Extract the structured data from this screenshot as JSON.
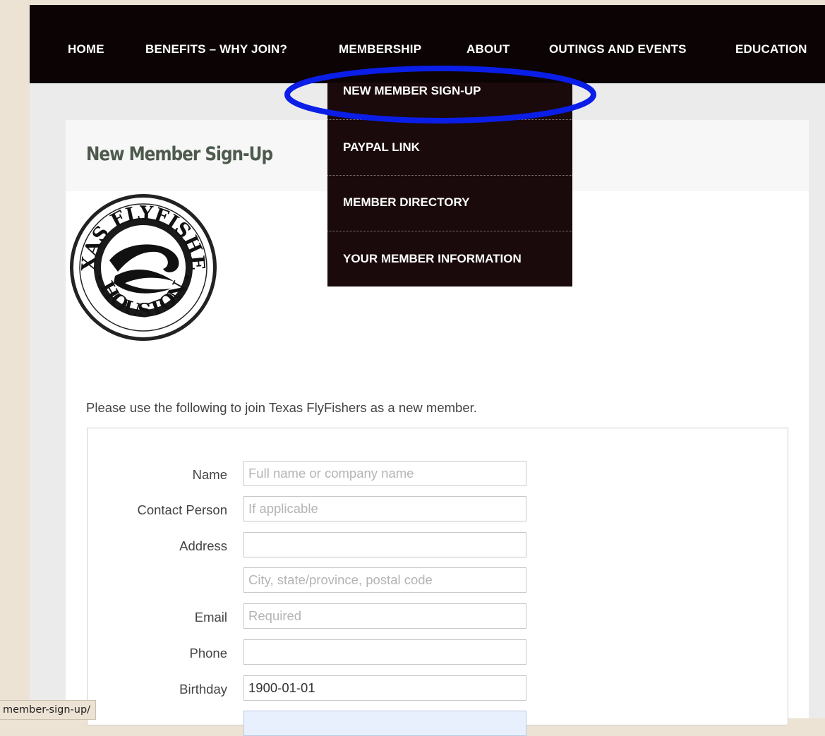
{
  "nav": {
    "items": [
      {
        "label": "HOME"
      },
      {
        "label": "BENEFITS – WHY JOIN?"
      },
      {
        "label": "MEMBERSHIP"
      },
      {
        "label": "ABOUT"
      },
      {
        "label": "OUTINGS AND EVENTS"
      },
      {
        "label": "EDUCATION"
      }
    ]
  },
  "dropdown": {
    "items": [
      {
        "label": "NEW MEMBER SIGN-UP",
        "highlighted": true
      },
      {
        "label": "PAYPAL LINK"
      },
      {
        "label": "MEMBER DIRECTORY"
      },
      {
        "label": "YOUR MEMBER INFORMATION"
      }
    ],
    "highlight_color": "#0a1ee8"
  },
  "page": {
    "title": "New Member Sign-Up",
    "intro": "Please use the following to join Texas FlyFishers as a new member."
  },
  "logo": {
    "text_top": "TEXAS FLYFISHERS",
    "text_bottom": "HOUSTON"
  },
  "form": {
    "fields": [
      {
        "label": "Name",
        "value": "",
        "placeholder": "Full name or company name"
      },
      {
        "label": "Contact Person",
        "value": "",
        "placeholder": "If applicable"
      },
      {
        "label": "Address",
        "value": "",
        "placeholder": ""
      },
      {
        "label": "",
        "value": "",
        "placeholder": "City, state/province, postal code"
      },
      {
        "label": "Email",
        "value": "",
        "placeholder": "Required"
      },
      {
        "label": "Phone",
        "value": "",
        "placeholder": ""
      },
      {
        "label": "Birthday",
        "value": "1900-01-01",
        "placeholder": ""
      },
      {
        "label": "",
        "value": "",
        "placeholder": ""
      }
    ]
  },
  "status_bar": {
    "url": "member-sign-up/"
  },
  "colors": {
    "navbar_bg": "#0c0304",
    "dropdown_bg": "#1a0a0b",
    "title_color": "#4d5a4d",
    "page_bg": "#ebebeb",
    "frame_bg": "#ece3d4"
  }
}
